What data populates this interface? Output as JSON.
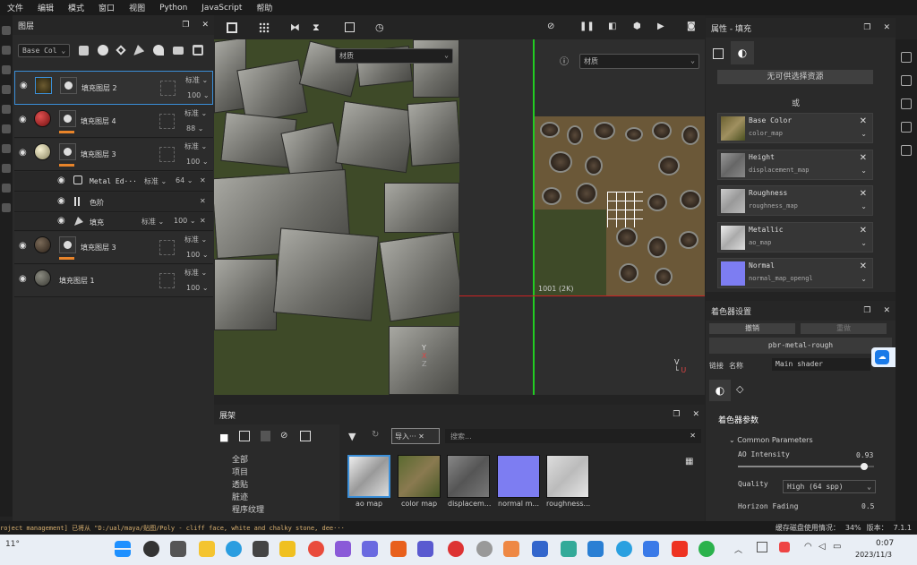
{
  "menu": [
    "文件",
    "编辑",
    "模式",
    "窗口",
    "视图",
    "Python",
    "JavaScript",
    "帮助"
  ],
  "layers_panel": {
    "title": "图层",
    "filter_value": "Base Col"
  },
  "layers": [
    {
      "name": "填充图层 2",
      "blend": "标准",
      "opacity": "100"
    },
    {
      "name": "填充图层 4",
      "blend": "标准",
      "opacity": "88"
    },
    {
      "name": "填充图层 3",
      "blend": "标准",
      "opacity": "100"
    },
    {
      "name": "Metal Ed···",
      "blend": "标准",
      "opacity": "64"
    },
    {
      "name": "色阶"
    },
    {
      "name": "填充",
      "blend": "标准",
      "opacity": "100"
    },
    {
      "name": "填充图层 3",
      "blend": "标准",
      "opacity": "100"
    },
    {
      "name": "填充图层 1",
      "blend": "标准",
      "opacity": "100"
    }
  ],
  "viewport": {
    "material_left": "材质",
    "material_right": "材质",
    "uv_label": "1001 (2K)"
  },
  "shelf": {
    "title": "展架",
    "tab": "导入···",
    "search_placeholder": "搜索...",
    "categories": [
      "全部",
      "项目",
      "透贴",
      "脏迹",
      "程序纹理"
    ],
    "assets": [
      "ao map",
      "color map",
      "displacem...",
      "normal m...",
      "roughness..."
    ]
  },
  "properties": {
    "title": "属性 - 填充",
    "no_resource": "无可供选择资源",
    "or": "或",
    "channels": [
      {
        "name": "Base Color",
        "map": "color_map"
      },
      {
        "name": "Height",
        "map": "displacement_map"
      },
      {
        "name": "Roughness",
        "map": "roughness_map"
      },
      {
        "name": "Metallic",
        "map": "ao_map"
      },
      {
        "name": "Normal",
        "map": "normal_map_opengl"
      }
    ]
  },
  "shader": {
    "title": "着色器设置",
    "undo": "撤销",
    "redo": "重做",
    "name": "pbr-metal-rough",
    "link_label": "链接",
    "name_label": "名称",
    "shader_value": "Main shader",
    "params_title": "着色器参数",
    "common": "Common Parameters",
    "ao_label": "AO Intensity",
    "ao_value": "0.93",
    "ao_fraction": 0.93,
    "quality_label": "Quality",
    "quality_value": "High (64 spp)",
    "horizon_label": "Horizon Fading",
    "horizon_value": "0.5"
  },
  "side_tab": "拖拽",
  "status": {
    "message": "roject management] 已将从 \"D:/ual/maya/贴图/Poly - cliff face, white and chalky stone, dee···",
    "cache": "缓存磁盘使用情况：",
    "cache_pct": "34%",
    "version_label": "版本：",
    "version": "7.1.1"
  },
  "taskbar": {
    "weather": "11°",
    "time": "0:07",
    "date": "2023/11/3"
  },
  "colors": {
    "accent": "#3b8fd9",
    "opacity_bar": "#e8842a",
    "uv_red": "#c22",
    "uv_green": "#2c2"
  }
}
